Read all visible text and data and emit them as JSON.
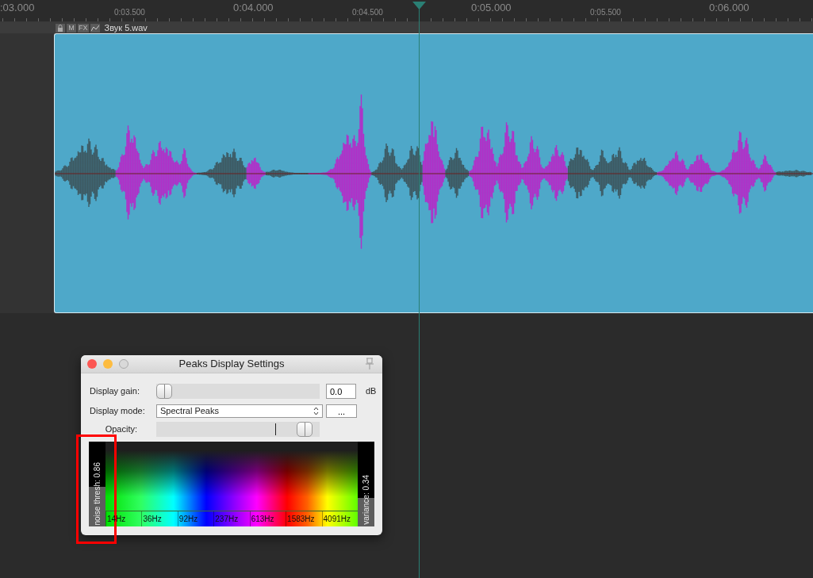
{
  "ruler": {
    "labels": [
      {
        "text": ":03.000",
        "kind": "major"
      },
      {
        "text": "0:03.500",
        "kind": "minor"
      },
      {
        "text": "0:04.000",
        "kind": "major"
      },
      {
        "text": "0:04.500",
        "kind": "minor"
      },
      {
        "text": "0:05.000",
        "kind": "major"
      },
      {
        "text": "0:05.500",
        "kind": "minor"
      },
      {
        "text": "0:06.000",
        "kind": "major"
      }
    ]
  },
  "track": {
    "buttons": [
      "M",
      "FX"
    ],
    "clip_name": "Звук 5.wav"
  },
  "dialog": {
    "title": "Peaks Display Settings",
    "gain": {
      "label": "Display gain:",
      "level": 0.0,
      "value": "0.0",
      "unit": "dB"
    },
    "mode": {
      "label": "Display mode:",
      "value": "Spectral Peaks",
      "more": "..."
    },
    "opacity": {
      "label": "Opacity:",
      "level": 0.95
    },
    "spectrum": {
      "left": {
        "text": "noise thresh: 0.86",
        "level": 0.47
      },
      "right": {
        "text": "variance: 0.34",
        "level": 0.34
      },
      "frequencies": [
        "14Hz",
        "36Hz",
        "92Hz",
        "237Hz",
        "613Hz",
        "1583Hz",
        "4091Hz"
      ]
    }
  }
}
